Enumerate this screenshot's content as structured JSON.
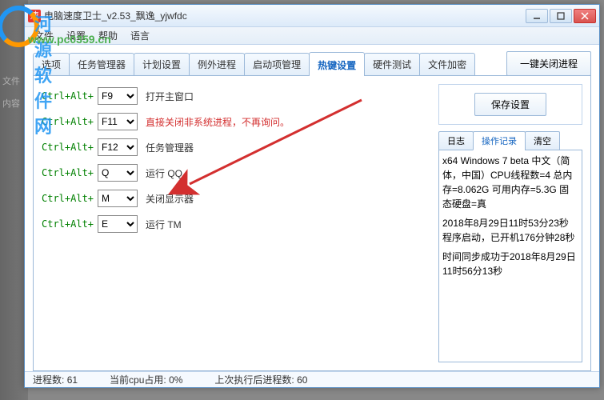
{
  "watermark": {
    "text": "河源软件网",
    "url": "www.pc0359.cn"
  },
  "window": {
    "title": "电脑速度卫士_v2.53_飘逸_yjwfdc",
    "icon_text": "速"
  },
  "menu": {
    "file": "文件",
    "settings": "设置",
    "help": "帮助",
    "lang": "语言"
  },
  "tabs": {
    "options": "选项",
    "taskmgr": "任务管理器",
    "plan": "计划设置",
    "exception": "例外进程",
    "startup": "启动项管理",
    "hotkey": "热键设置",
    "hwtest": "硬件测试",
    "encrypt": "文件加密"
  },
  "big_button": "一键关闭进程",
  "hotkeys": [
    {
      "prefix": "Ctrl+Alt+",
      "key": "F9",
      "desc": "打开主窗口",
      "red": false
    },
    {
      "prefix": "Ctrl+Alt+",
      "key": "F11",
      "desc": "直接关闭非系统进程，不再询问。",
      "red": true
    },
    {
      "prefix": "Ctrl+Alt+",
      "key": "F12",
      "desc": "任务管理器",
      "red": false
    },
    {
      "prefix": "Ctrl+Alt+",
      "key": "Q",
      "desc": "运行 QQ",
      "red": false
    },
    {
      "prefix": "Ctrl+Alt+",
      "key": "M",
      "desc": "关闭显示器",
      "red": false
    },
    {
      "prefix": "Ctrl+Alt+",
      "key": "E",
      "desc": "运行 TM",
      "red": false
    }
  ],
  "save_button": "保存设置",
  "log_tabs": {
    "log": "日志",
    "ops": "操作记录",
    "clear": "清空"
  },
  "log_lines": [
    "x64 Windows 7 beta  中文（简体，中国）CPU线程数=4 总内存=8.062G 可用内存=5.3G 固态硬盘=真",
    "2018年8月29日11时53分23秒 程序启动，已开机176分钟28秒",
    "时间同步成功于2018年8月29日11时56分13秒"
  ],
  "status": {
    "procs_label": "进程数:",
    "procs_val": "61",
    "cpu_label": "当前cpu占用:",
    "cpu_val": "0%",
    "last_label": "上次执行后进程数:",
    "last_val": "60"
  }
}
